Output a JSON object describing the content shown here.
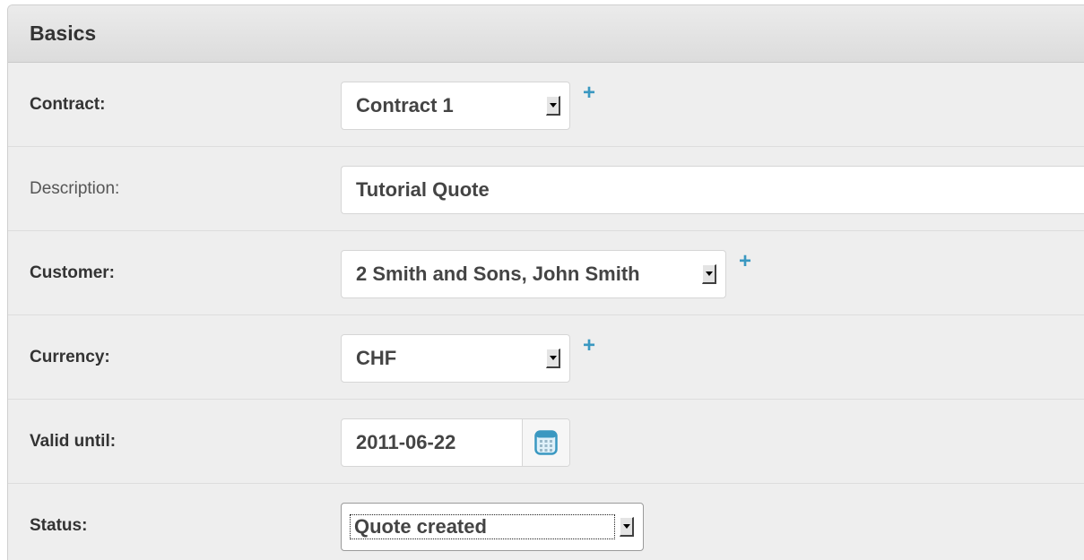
{
  "fieldset": {
    "title": "Basics"
  },
  "fields": {
    "contract": {
      "label": "Contract:",
      "value": "Contract 1",
      "add_icon": "plus-icon"
    },
    "description": {
      "label": "Description:",
      "value": "Tutorial Quote"
    },
    "customer": {
      "label": "Customer:",
      "value": "2 Smith and Sons, John Smith",
      "add_icon": "plus-icon"
    },
    "currency": {
      "label": "Currency:",
      "value": "CHF",
      "add_icon": "plus-icon"
    },
    "valid_until": {
      "label": "Valid until:",
      "value": "2011-06-22",
      "picker_icon": "calendar-icon"
    },
    "status": {
      "label": "Status:",
      "value": "Quote created"
    }
  },
  "colors": {
    "accent": "#3a98c1",
    "background": "#eeeeee",
    "header": "#dcdcdc",
    "text": "#333333"
  }
}
